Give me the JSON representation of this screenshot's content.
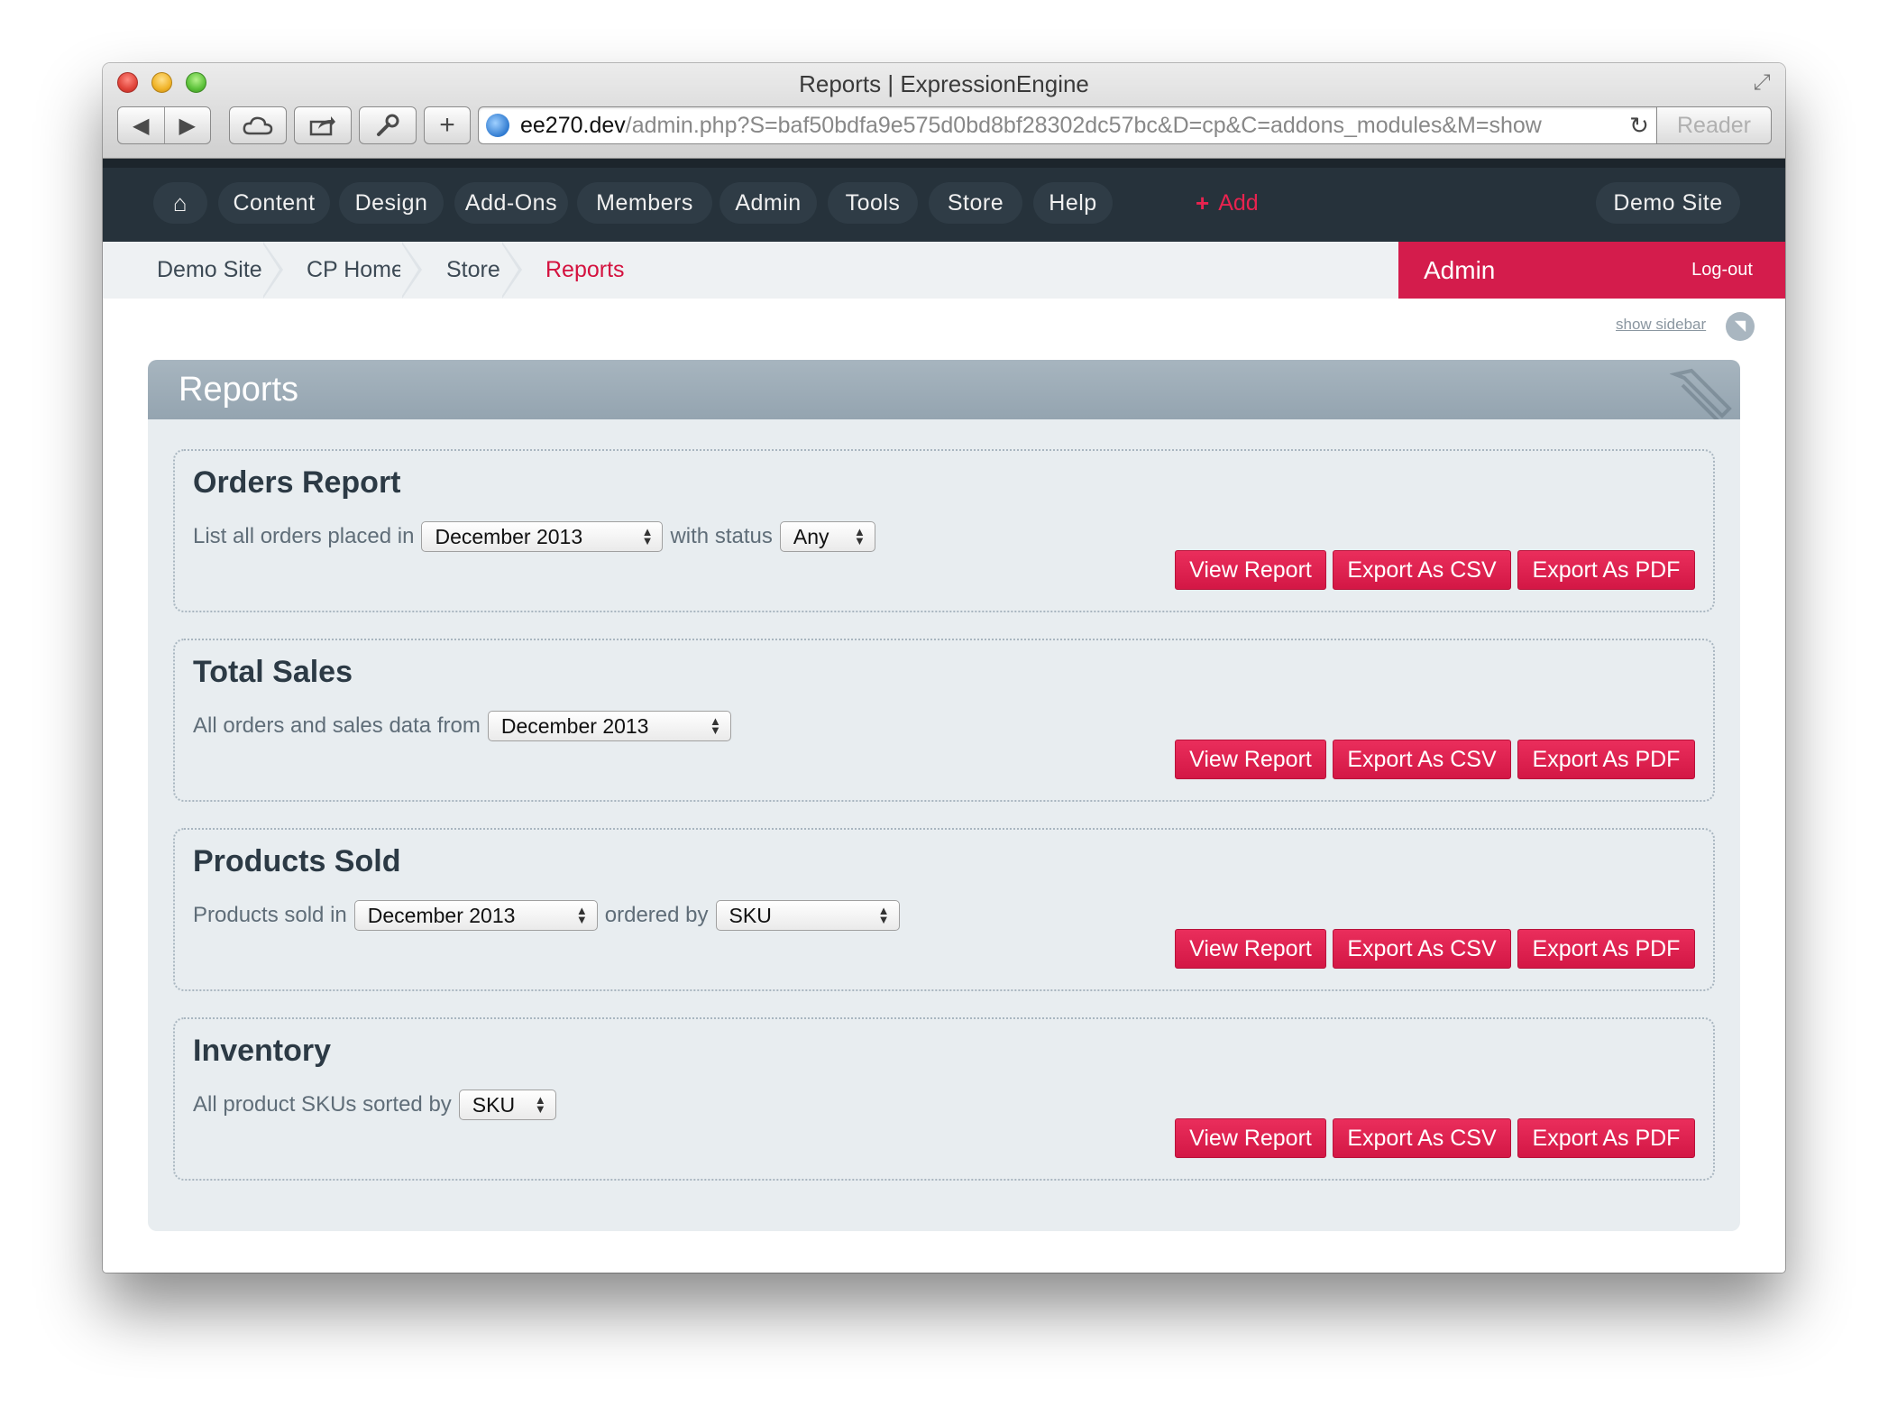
{
  "window": {
    "title": "Reports | ExpressionEngine",
    "url_host": "ee270.dev",
    "url_path": "/admin.php?S=baf50bdfa9e575d0bd8bf28302dc57bc&D=cp&C=addons_modules&M=show",
    "reader_label": "Reader"
  },
  "nav": {
    "items": [
      "Content",
      "Design",
      "Add-Ons",
      "Members",
      "Admin",
      "Tools",
      "Store",
      "Help"
    ],
    "add_label": "Add",
    "site_label": "Demo Site"
  },
  "breadcrumb": [
    "Demo Site",
    "CP Home",
    "Store",
    "Reports"
  ],
  "admin": {
    "label": "Admin",
    "logout": "Log-out",
    "show_sidebar": "show sidebar"
  },
  "panel": {
    "title": "Reports"
  },
  "buttons": {
    "view": "View Report",
    "csv": "Export As CSV",
    "pdf": "Export As PDF"
  },
  "reports": [
    {
      "title": "Orders Report",
      "text1": "List all orders placed in",
      "select1": "December 2013",
      "text2": "with status",
      "select2": "Any"
    },
    {
      "title": "Total Sales",
      "text1": "All orders and sales data from",
      "select1": "December 2013"
    },
    {
      "title": "Products Sold",
      "text1": "Products sold in",
      "select1": "December 2013",
      "text2": "ordered by",
      "select2": "SKU"
    },
    {
      "title": "Inventory",
      "text1": "All product SKUs sorted by",
      "select1": "SKU"
    }
  ]
}
